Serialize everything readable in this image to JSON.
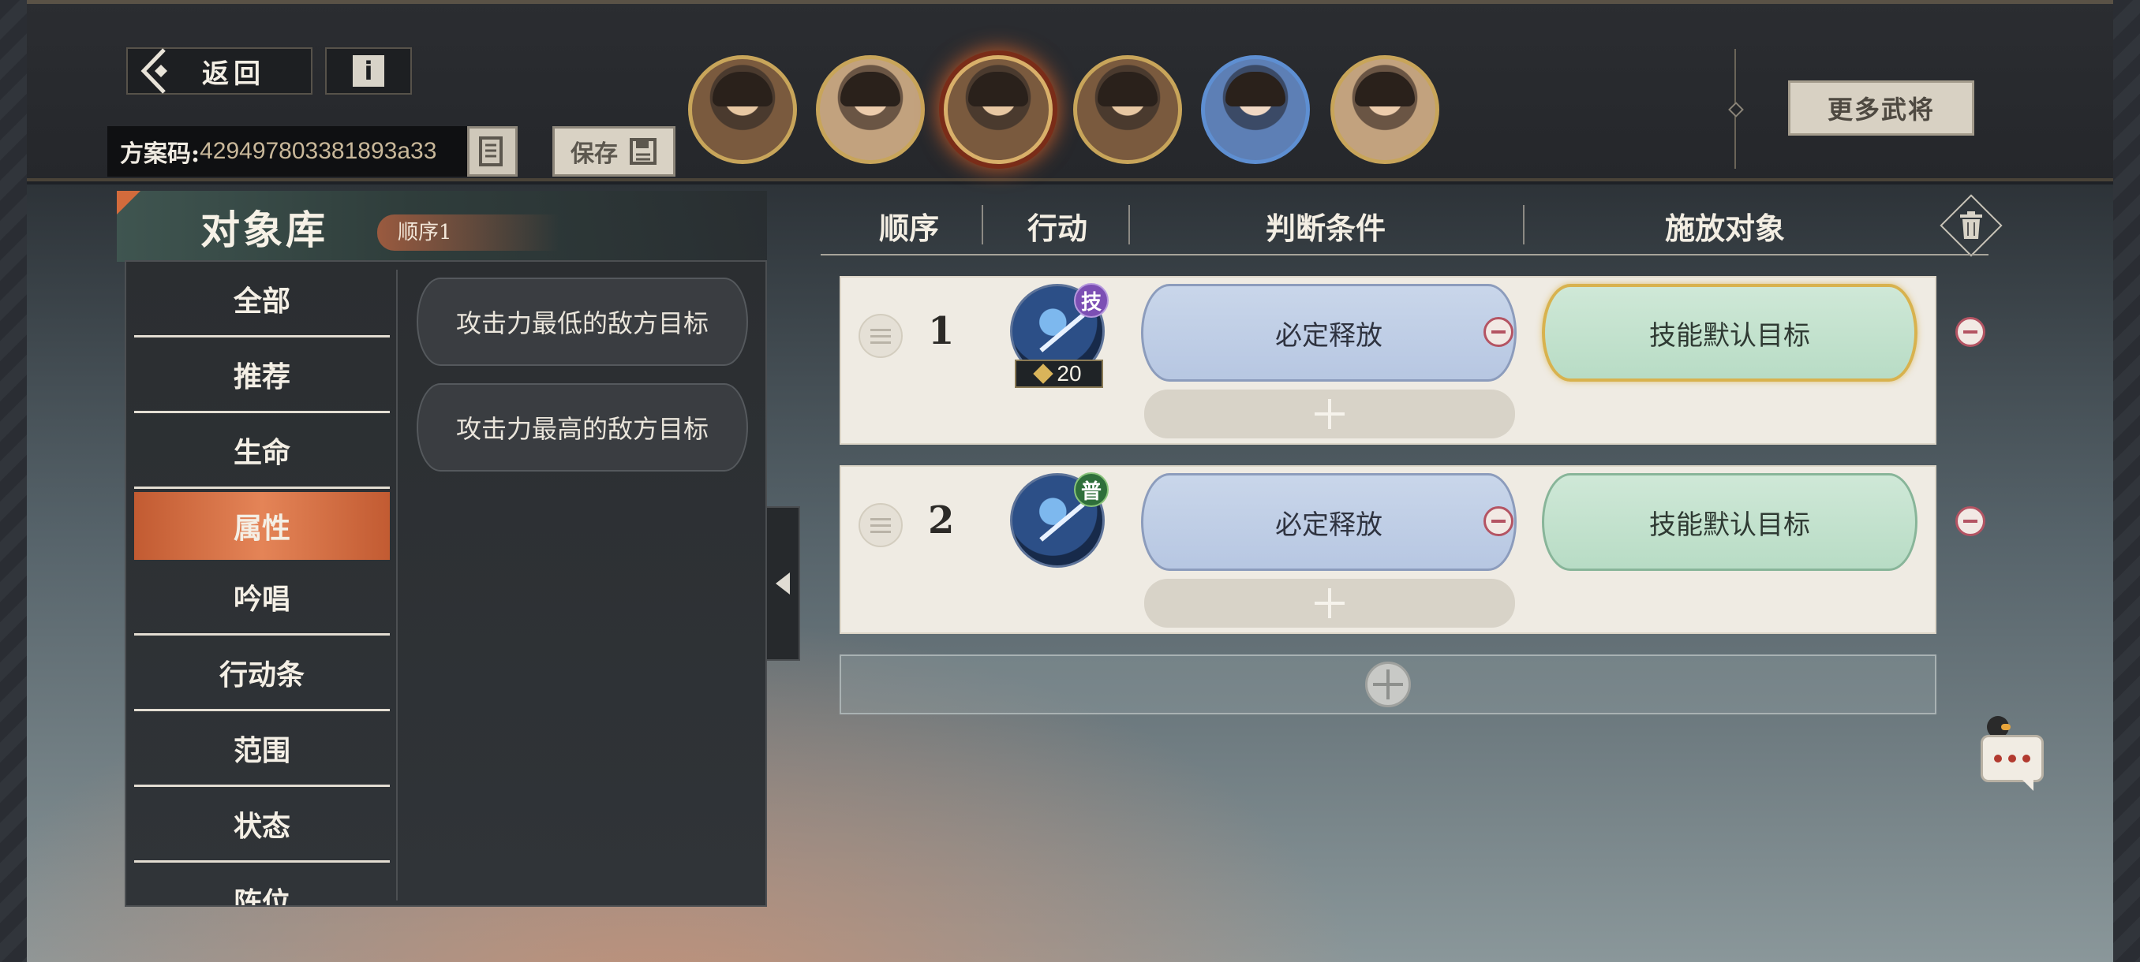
{
  "header": {
    "back_label": "返回",
    "plan_code_label": "方案码:",
    "plan_code_value": "42949780338189За33",
    "save_label": "保存",
    "more_generals_label": "更多武将"
  },
  "portraits": [
    {
      "name": "general-1",
      "selected": false
    },
    {
      "name": "general-2",
      "selected": false
    },
    {
      "name": "general-3",
      "selected": true
    },
    {
      "name": "general-4",
      "selected": false
    },
    {
      "name": "general-5",
      "selected": false
    },
    {
      "name": "general-6",
      "selected": false
    }
  ],
  "library": {
    "title": "对象库",
    "order_tag": "顺序1",
    "categories": [
      "全部",
      "推荐",
      "生命",
      "属性",
      "吟唱",
      "行动条",
      "范围",
      "状态",
      "阵位"
    ],
    "active_category": "属性",
    "options": [
      "攻击力最低的敌方目标",
      "攻击力最高的敌方目标"
    ]
  },
  "table": {
    "headers": {
      "order": "顺序",
      "action": "行动",
      "condition": "判断条件",
      "target": "施放对象"
    },
    "rows": [
      {
        "order": "1",
        "skill_tag": "技",
        "cost": "20",
        "condition": "必定释放",
        "target": "技能默认目标"
      },
      {
        "order": "2",
        "skill_tag": "普",
        "condition": "必定释放",
        "target": "技能默认目标"
      }
    ]
  },
  "colors": {
    "accent_orange": "#e07a4c",
    "condition_blue": "#c3d1e8",
    "target_green": "#c4e2cf",
    "selected_gold": "#d8b24e",
    "panel_dark": "#2d3033"
  }
}
